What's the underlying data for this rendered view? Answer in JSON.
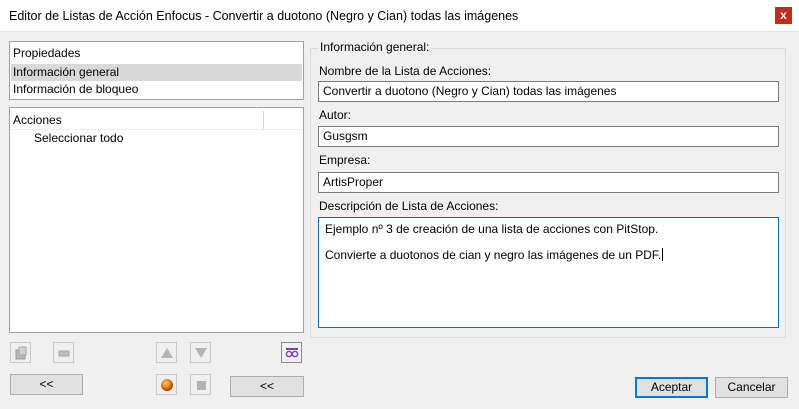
{
  "window": {
    "title": "Editor de Listas de Acción Enfocus - Convertir a duotono (Negro y Cian) todas las imágenes",
    "close_glyph": "x"
  },
  "properties_list": {
    "header": "Propiedades",
    "items": [
      {
        "label": "Información general",
        "selected": true
      },
      {
        "label": "Información de bloqueo",
        "selected": false
      }
    ]
  },
  "actions_list": {
    "header": "Acciones",
    "items": [
      {
        "label": "Seleccionar todo"
      }
    ]
  },
  "general_info": {
    "group_label": "Información general:",
    "name_label": "Nombre de la Lista de Acciones:",
    "name_value": "Convertir a duotono (Negro y Cian) todas las imágenes",
    "author_label": "Autor:",
    "author_value": "Gusgsm",
    "company_label": "Empresa:",
    "company_value": "ArtisProper",
    "description_label": "Descripción de Lista de Acciones:",
    "description_lines": [
      "Ejemplo nº 3 de creación de una lista de acciones con PitStop.",
      "Convierte a duotonos de cian y negro las imágenes de un PDF."
    ]
  },
  "toolbar": {
    "icons": [
      "add-action-icon",
      "remove-action-icon",
      "move-up-icon",
      "move-down-icon",
      "preview-glasses-icon",
      "record-icon",
      "stop-icon"
    ]
  },
  "buttons": {
    "collapse_left": "<<",
    "collapse_right": "<<",
    "accept": "Aceptar",
    "cancel": "Cancelar"
  },
  "colors": {
    "close_button": "#c42b1c",
    "focus_border": "#0078d7",
    "selected_row": "#d9d9d9",
    "record_button": "#e8620c"
  }
}
